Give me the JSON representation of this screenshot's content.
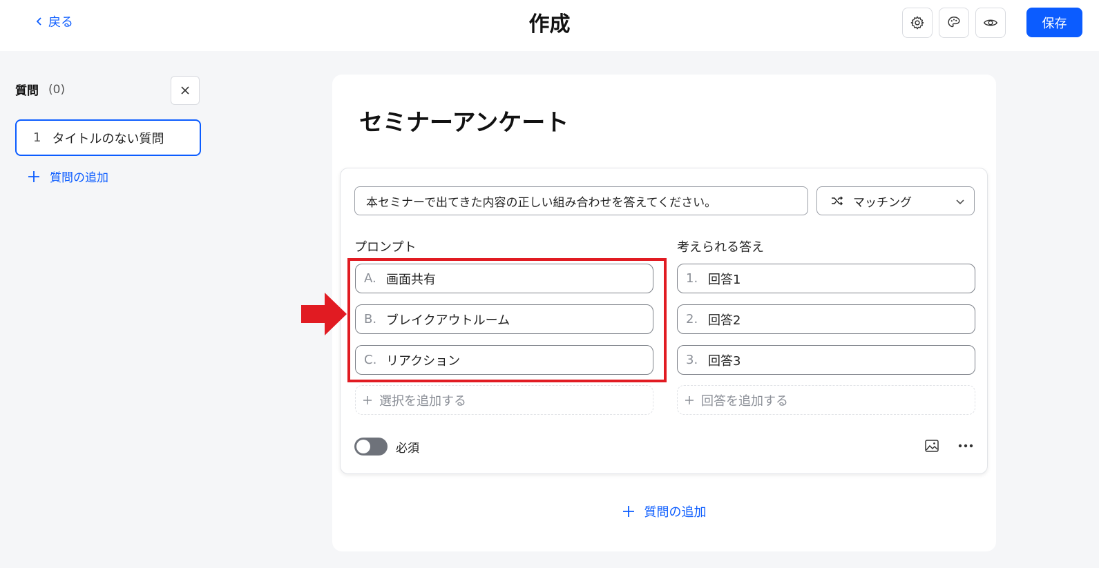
{
  "header": {
    "back_label": "戻る",
    "title": "作成",
    "save_label": "保存"
  },
  "sidebar": {
    "heading": "質問",
    "count": "(0)",
    "items": [
      {
        "number": "1",
        "label": "タイトルのない質問"
      }
    ],
    "add_label": "質問の追加"
  },
  "survey": {
    "title": "セミナーアンケート",
    "question": {
      "text": "本セミナーで出てきた内容の正しい組み合わせを答えてください。",
      "type": "マッチング",
      "prompts_label": "プロンプト",
      "answers_label": "考えられる答え",
      "prompts": [
        {
          "prefix": "A.",
          "text": "画面共有"
        },
        {
          "prefix": "B.",
          "text": "ブレイクアウトルーム"
        },
        {
          "prefix": "C.",
          "text": "リアクション"
        }
      ],
      "answers": [
        {
          "prefix": "1.",
          "text": "回答1"
        },
        {
          "prefix": "2.",
          "text": "回答2"
        },
        {
          "prefix": "3.",
          "text": "回答3"
        }
      ],
      "add_prompt_label": "選択を追加する",
      "add_answer_label": "回答を追加する",
      "required_label": "必須",
      "required": false
    },
    "add_question_label": "質問の追加"
  },
  "colors": {
    "accent": "#0b5cff",
    "highlight": "#e11b22"
  },
  "icons": [
    "chevron-left-icon",
    "gear-icon",
    "palette-icon",
    "eye-icon",
    "close-icon",
    "plus-icon",
    "shuffle-icon",
    "chevron-down-icon",
    "image-icon",
    "more-icon",
    "arrow-right-icon"
  ]
}
